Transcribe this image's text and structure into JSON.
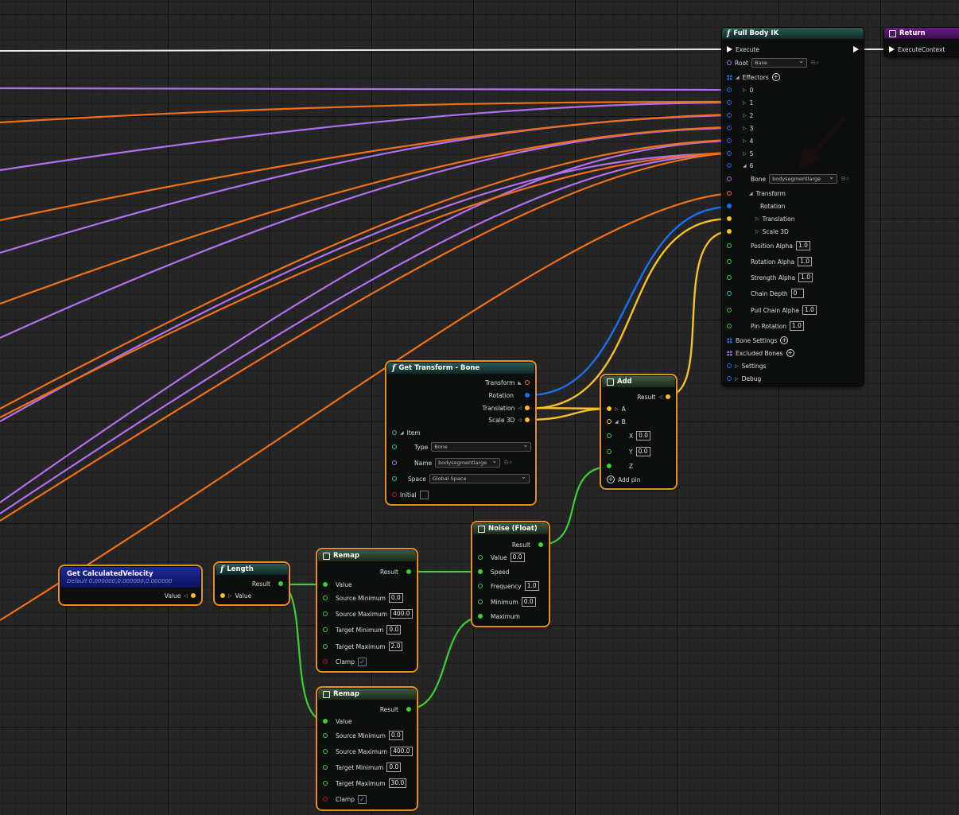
{
  "full_body_ik": {
    "title": "Full Body IK",
    "execute": "Execute",
    "root_label": "Root",
    "root_value": "Base",
    "effectors_label": "Effectors",
    "effector_indices": [
      "0",
      "1",
      "2",
      "3",
      "4",
      "5",
      "6"
    ],
    "bone_label": "Bone",
    "bone_value": "bodysegmentlarge",
    "transform_label": "Transform",
    "rotation_label": "Rotation",
    "translation_label": "Translation",
    "scale_label": "Scale 3D",
    "position_alpha_label": "Position Alpha",
    "position_alpha": "1.0",
    "rotation_alpha_label": "Rotation Alpha",
    "rotation_alpha": "1.0",
    "strength_alpha_label": "Strength Alpha",
    "strength_alpha": "1.0",
    "chain_depth_label": "Chain Depth",
    "chain_depth": "0",
    "pull_chain_alpha_label": "Pull Chain Alpha",
    "pull_chain_alpha": "1.0",
    "pin_rotation_label": "Pin Rotation",
    "pin_rotation": "1.0",
    "bone_settings_label": "Bone Settings",
    "excluded_bones_label": "Excluded Bones",
    "settings_label": "Settings",
    "debug_label": "Debug"
  },
  "return_node": {
    "title": "Return",
    "execute_context": "ExecuteContext"
  },
  "get_transform": {
    "title": "Get Transform - Bone",
    "transform": "Transform",
    "rotation": "Rotation",
    "translation": "Translation",
    "scale": "Scale 3D",
    "item": "Item",
    "type_label": "Type",
    "type_value": "Bone",
    "name_label": "Name",
    "name_value": "bodysegmentlarge",
    "space_label": "Space",
    "space_value": "Global Space",
    "initial_label": "Initial"
  },
  "add_node": {
    "title": "Add",
    "result": "Result",
    "a": "A",
    "b": "B",
    "x_label": "X",
    "x": "0.0",
    "y_label": "Y",
    "y": "0.0",
    "z_label": "Z",
    "add_pin": "Add pin"
  },
  "noise_node": {
    "title": "Noise (Float)",
    "result": "Result",
    "value_label": "Value",
    "value": "0.0",
    "speed": "Speed",
    "frequency_label": "Frequency",
    "frequency": "1.0",
    "minimum_label": "Minimum",
    "minimum": "0.0",
    "maximum": "Maximum"
  },
  "velocity_node": {
    "title": "Get CalculatedVelocity",
    "default_text": "Default 0.000000,0.000000,0.000000",
    "value": "Value"
  },
  "length_node": {
    "title": "Length",
    "result": "Result",
    "value": "Value"
  },
  "remap1": {
    "title": "Remap",
    "result": "Result",
    "value": "Value",
    "src_min_label": "Source Minimum",
    "src_min": "0.0",
    "src_max_label": "Source Maximum",
    "src_max": "400.0",
    "tgt_min_label": "Target Minimum",
    "tgt_min": "0.0",
    "tgt_max_label": "Target Maximum",
    "tgt_max": "2.0",
    "clamp": "Clamp"
  },
  "remap2": {
    "title": "Remap",
    "result": "Result",
    "value": "Value",
    "src_min_label": "Source Minimum",
    "src_min": "0.0",
    "src_max_label": "Source Maximum",
    "src_max": "400.0",
    "tgt_min_label": "Target Minimum",
    "tgt_min": "0.0",
    "tgt_max_label": "Target Maximum",
    "tgt_max": "30.0",
    "clamp": "Clamp"
  },
  "colors": {
    "float": "#3cd030",
    "vector": "#f8c020",
    "struct": "#f07018",
    "rotator": "#1870f0",
    "name": "#b070f0",
    "annotation_arrow": "#e8202a"
  }
}
